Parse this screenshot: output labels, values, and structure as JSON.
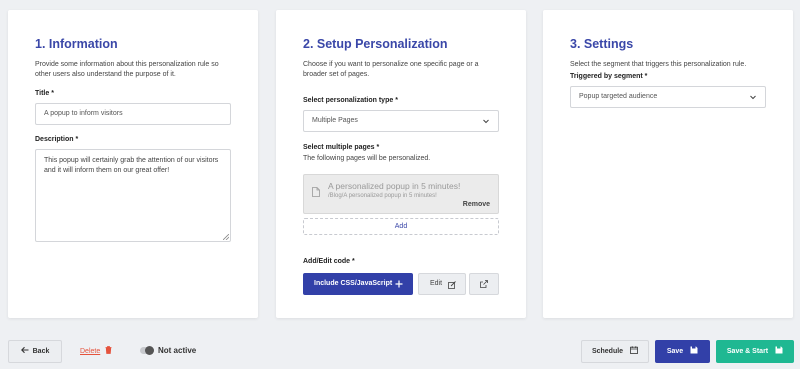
{
  "info": {
    "heading": "1. Information",
    "description": "Provide some information about this personalization rule so other users also understand the purpose of it.",
    "title_label": "Title *",
    "title_value": "A popup to inform visitors",
    "description_label": "Description *",
    "description_value": "This popup will certainly grab the attention of our visitors and it will inform them on our great offer!"
  },
  "setup": {
    "heading": "2. Setup Personalization",
    "description": "Choose if you want to personalize one specific page or a broader set of pages.",
    "type_label": "Select personalization type *",
    "type_value": "Multiple Pages",
    "pages_label": "Select multiple pages *",
    "pages_note": "The following pages will be personalized.",
    "page_item": {
      "title": "A personalized popup in 5 minutes!",
      "path": "/Blog/A personalized popup in 5 minutes!",
      "remove_label": "Remove"
    },
    "add_label": "Add",
    "code_label": "Add/Edit code *",
    "include_button": "Include CSS/JavaScript",
    "edit_button": "Edit"
  },
  "settings": {
    "heading": "3. Settings",
    "description": "Select the segment that triggers this personalization rule.",
    "segment_label": "Triggered by segment *",
    "segment_value": "Popup targeted audience"
  },
  "footer": {
    "back": "Back",
    "delete": "Delete",
    "status": "Not active",
    "schedule": "Schedule",
    "save": "Save",
    "save_start": "Save & Start"
  },
  "colors": {
    "accent": "#3240a8",
    "heading": "#3a47a8",
    "delete": "#e5533d",
    "start": "#1fb892"
  }
}
